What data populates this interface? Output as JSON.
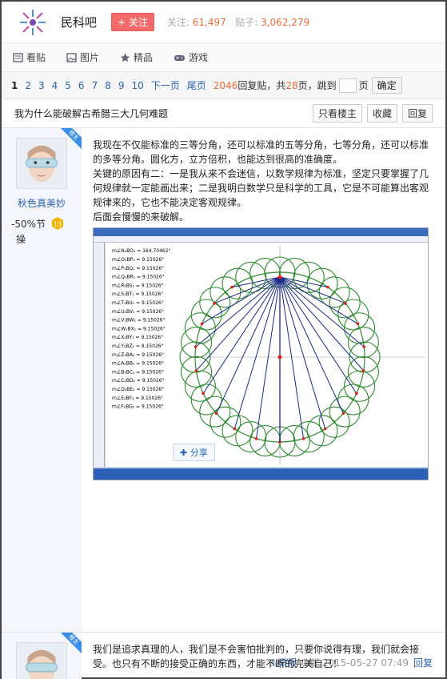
{
  "header": {
    "bar_name": "民科吧",
    "follow_label": "+ 关注",
    "followers_label": "关注:",
    "followers": "61,497",
    "posts_label": "贴子:",
    "posts": "3,062,279"
  },
  "nav": [
    {
      "label": "看贴",
      "icon": "list-icon"
    },
    {
      "label": "图片",
      "icon": "picture-icon"
    },
    {
      "label": "精品",
      "icon": "star-icon"
    },
    {
      "label": "游戏",
      "icon": "gamepad-icon"
    }
  ],
  "pager": {
    "current": "1",
    "pages": [
      "2",
      "3",
      "4",
      "5",
      "6",
      "7",
      "8",
      "9",
      "10"
    ],
    "next": "下一页",
    "last": "尾页",
    "reply_count": "2046",
    "reply_text": "回复贴，共",
    "total_pages": "28",
    "pages_text": "页，跳到",
    "page_unit": "页",
    "confirm": "确定"
  },
  "thread": {
    "title": "我为什么能破解古希腊三大几何难题",
    "only_op": "只看楼主",
    "favorite": "收藏",
    "reply": "回复"
  },
  "post1": {
    "badge": "楼主",
    "username": "秋色真美妙",
    "level_text": "-50%节",
    "level_text2": "操",
    "level_num": "13",
    "para1": "我现在不仅能标准的三等分角，还可以标准的五等分角，七等分角，还可以标准的多等分角。圆化方，立方倍积，也能达到很高的准确度。",
    "para2": "关键的原因有二：一是我从来不会迷信，以数学规律为标准，坚定只要掌握了几何规律就一定能画出来；二是我明白数学只是科学的工具，它是不可能算出客观规律来的，它也不能决定客观规律。",
    "para3": "后面会慢慢的来破解。",
    "share": "分享",
    "report": "举报",
    "floor": "1楼",
    "time": "2015-05-27 07:49",
    "reply": "回复",
    "measure_first": "m∠N₁BO₁ = 164.70462°",
    "measure_rest": "= 9.15026°",
    "labels": [
      "m∠O₁BP₁",
      "m∠P₁BQ₁",
      "m∠Q₁BR₁",
      "m∠R₁BS₁",
      "m∠S₁BT₁",
      "m∠T₁BU₁",
      "m∠U₁BV₁",
      "m∠V₁BW₁",
      "m∠W₁BX₁",
      "m∠X₁BY₁",
      "m∠Y₁BZ₁",
      "m∠Z₁BA₂",
      "m∠A₂BB₂",
      "m∠B₂BC₂",
      "m∠C₂BD₂",
      "m∠D₂BE₂",
      "m∠E₂BF₂",
      "m∠F₂BG₂"
    ]
  },
  "post2": {
    "badge": "楼主",
    "text": "我们是追求真理的人，我们是不会害怕批判的，只要你说得有理，我们就会接受。也只有不断的接受正确的东西，才能不断的完美自己！"
  },
  "colors": {
    "accent": "#2d64b3",
    "follow": "#f56b6b",
    "number": "#f06a3a",
    "circle": "#2e8b2e",
    "line": "#1a2a8a"
  }
}
